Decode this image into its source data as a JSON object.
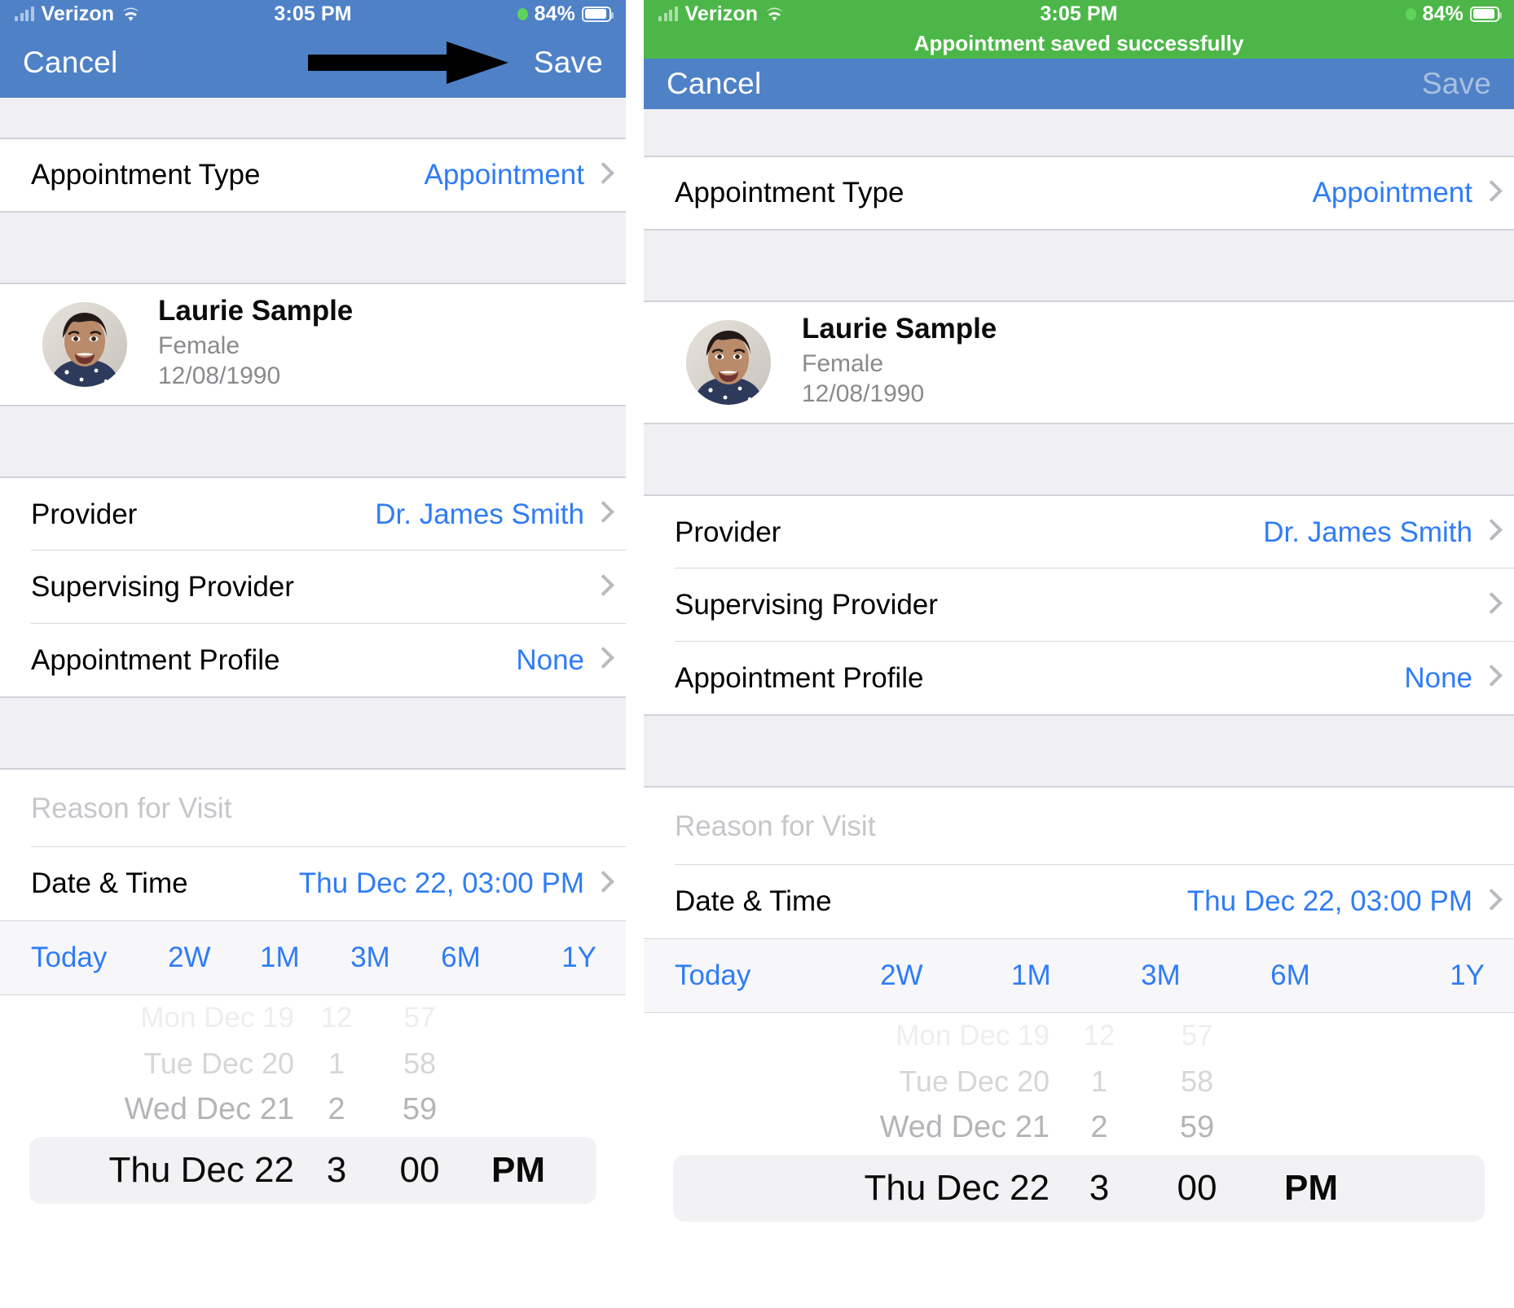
{
  "status_bar": {
    "carrier": "Verizon",
    "time": "3:05 PM",
    "battery_pct": "84%",
    "signal_icon": "signal-bars-icon",
    "wifi_icon": "wifi-icon",
    "battery_icon": "battery-icon",
    "dot_icon": "green-dot-icon"
  },
  "colors": {
    "nav_blue": "#4f81c7",
    "toast_green": "#4cb748",
    "link_blue": "#2f7cf6",
    "group_bg": "#f0eff4",
    "disabled_save": "#a9c0e0"
  },
  "navbar": {
    "cancel_label": "Cancel",
    "save_label": "Save"
  },
  "left": {
    "annotation_icon": "right-arrow-annotation",
    "save_enabled": true
  },
  "right": {
    "toast_message": "Appointment saved successfully",
    "save_enabled": false
  },
  "form": {
    "appointment_type": {
      "label": "Appointment Type",
      "value": "Appointment"
    },
    "patient": {
      "name": "Laurie Sample",
      "gender": "Female",
      "dob": "12/08/1990",
      "avatar_icon": "patient-avatar-photo"
    },
    "provider": {
      "label": "Provider",
      "value": "Dr. James Smith"
    },
    "supervising_provider": {
      "label": "Supervising Provider",
      "value": ""
    },
    "appointment_profile": {
      "label": "Appointment Profile",
      "value": "None"
    },
    "reason_for_visit": {
      "placeholder": "Reason for Visit",
      "value": ""
    },
    "date_time": {
      "label": "Date & Time",
      "value": "Thu Dec 22, 03:00 PM"
    }
  },
  "quick_ranges": [
    {
      "label": "Today"
    },
    {
      "label": "2W"
    },
    {
      "label": "1M"
    },
    {
      "label": "3M"
    },
    {
      "label": "6M"
    },
    {
      "label": "1Y"
    }
  ],
  "picker": {
    "rows": [
      {
        "date": "Mon Dec 19",
        "hour": "12",
        "minute": "57"
      },
      {
        "date": "Tue Dec 20",
        "hour": "1",
        "minute": "58"
      },
      {
        "date": "Wed Dec 21",
        "hour": "2",
        "minute": "59"
      }
    ],
    "selected": {
      "date": "Thu Dec 22",
      "hour": "3",
      "minute": "00",
      "meridiem": "PM"
    }
  }
}
